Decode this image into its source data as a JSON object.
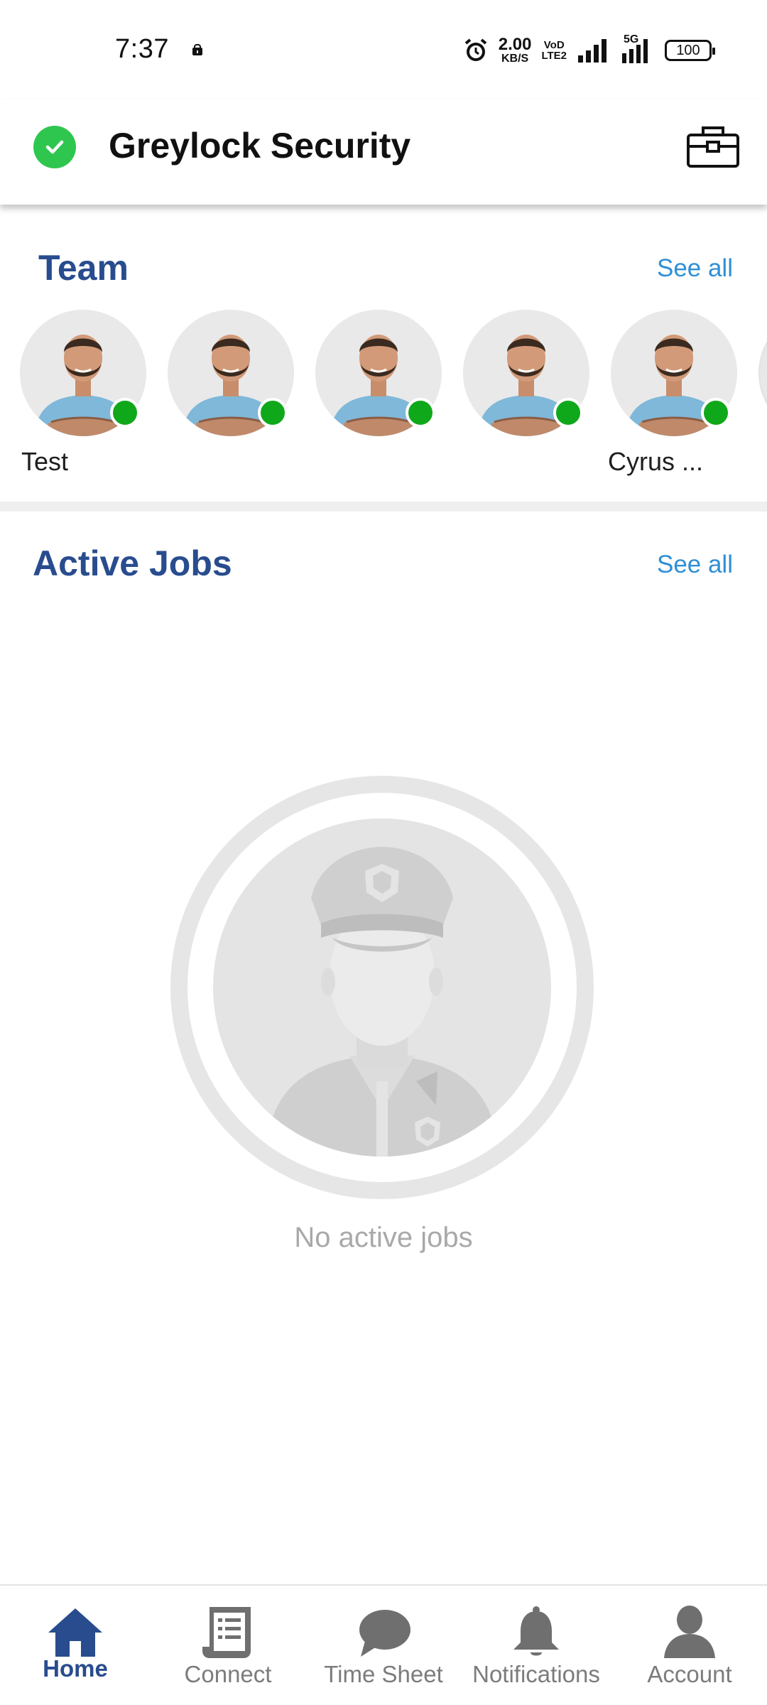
{
  "status_bar": {
    "time": "7:37",
    "net_speed_value": "2.00",
    "net_speed_unit": "KB/S",
    "volte_top": "VoD",
    "volte_bottom": "LTE2",
    "network_label": "5G",
    "battery": "100"
  },
  "header": {
    "title": "Greylock Security",
    "status_icon": "check-circle-icon",
    "action_icon": "toolbox-icon",
    "accent": "#2fc64f"
  },
  "team": {
    "title": "Team",
    "see_all": "See all",
    "members": [
      {
        "name": "Test",
        "online": true
      },
      {
        "name": "",
        "online": true
      },
      {
        "name": "",
        "online": true
      },
      {
        "name": "",
        "online": true
      },
      {
        "name": "Cyrus ...",
        "online": true
      }
    ]
  },
  "active_jobs": {
    "title": "Active Jobs",
    "see_all": "See all",
    "empty_message": "No active jobs"
  },
  "bottom_nav": {
    "items": [
      {
        "label": "Home",
        "icon": "home-icon",
        "active": true
      },
      {
        "label": "Connect",
        "icon": "document-icon",
        "active": false
      },
      {
        "label": "Time Sheet",
        "icon": "chat-bubble-icon",
        "active": false
      },
      {
        "label": "Notifications",
        "icon": "bell-icon",
        "active": false
      },
      {
        "label": "Account",
        "icon": "person-icon",
        "active": false
      }
    ]
  },
  "colors": {
    "brand_blue": "#284c8e",
    "link_blue": "#2f8fd6",
    "online_green": "#0fa81a"
  }
}
